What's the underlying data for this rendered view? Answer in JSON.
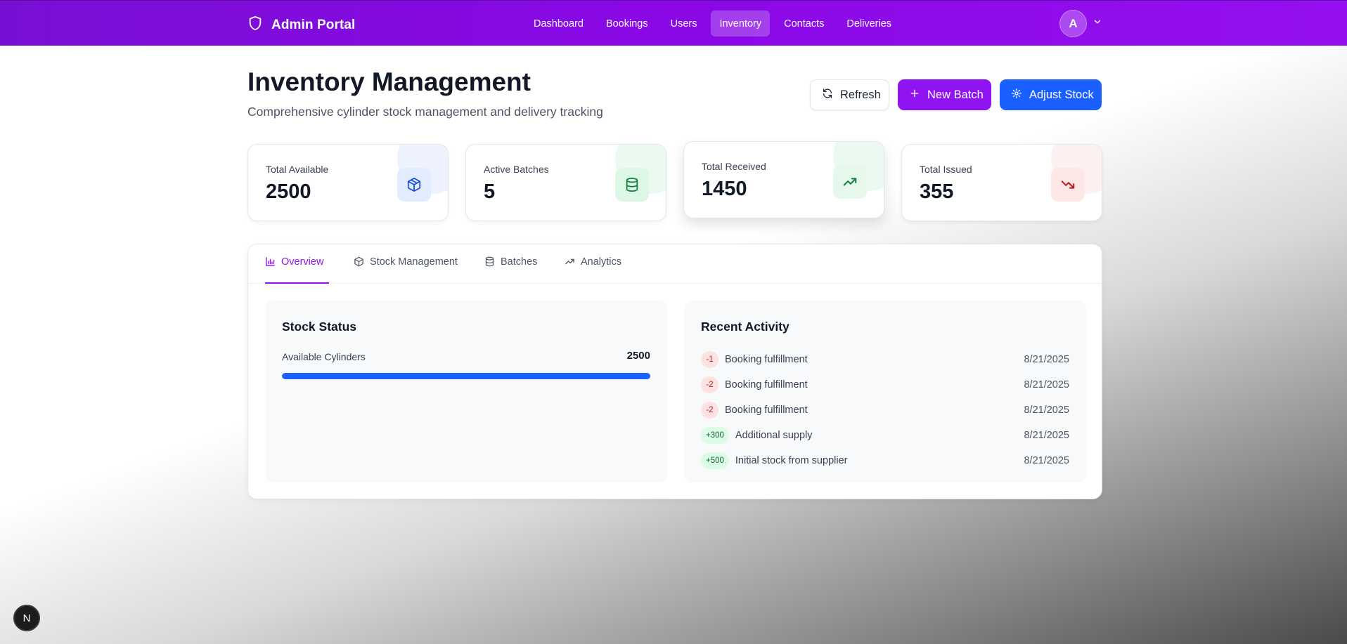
{
  "colors": {
    "brand_purple": "#9013f2",
    "primary_blue": "#1a5fff",
    "danger_red": "#b91c1c",
    "success_green": "#166534"
  },
  "nav": {
    "brand": {
      "icon": "shield-icon",
      "title": "Admin Portal"
    },
    "items": [
      {
        "label": "Dashboard",
        "active": false
      },
      {
        "label": "Bookings",
        "active": false
      },
      {
        "label": "Users",
        "active": false
      },
      {
        "label": "Inventory",
        "active": true
      },
      {
        "label": "Contacts",
        "active": false
      },
      {
        "label": "Deliveries",
        "active": false
      }
    ],
    "user": {
      "avatar_initial": "A",
      "menu_icon": "chevron-down-icon"
    }
  },
  "header": {
    "title": "Inventory Management",
    "subtitle": "Comprehensive cylinder stock management and delivery tracking",
    "actions": {
      "refresh": {
        "label": "Refresh",
        "icon": "refresh-icon"
      },
      "new_batch": {
        "label": "New Batch",
        "icon": "plus-icon"
      },
      "adjust_stock": {
        "label": "Adjust Stock",
        "icon": "gear-icon"
      }
    }
  },
  "stats": [
    {
      "label": "Total Available",
      "value": "2500",
      "icon": "package-icon",
      "color": "#1d4ed8"
    },
    {
      "label": "Active Batches",
      "value": "5",
      "icon": "database-icon",
      "color": "#15803d"
    },
    {
      "label": "Total Received",
      "value": "1450",
      "icon": "trending-up-icon",
      "color": "#15803d"
    },
    {
      "label": "Total Issued",
      "value": "355",
      "icon": "trending-down-icon",
      "color": "#b91c1c"
    }
  ],
  "tabs": [
    {
      "label": "Overview",
      "icon": "bar-chart-icon",
      "active": true
    },
    {
      "label": "Stock Management",
      "icon": "package-icon",
      "active": false
    },
    {
      "label": "Batches",
      "icon": "database-icon",
      "active": false
    },
    {
      "label": "Analytics",
      "icon": "trending-up-icon",
      "active": false
    }
  ],
  "stock_status": {
    "title": "Stock Status",
    "row_label": "Available Cylinders",
    "row_value": "2500",
    "progress_fraction": 1.0
  },
  "recent_activity": {
    "title": "Recent Activity",
    "items": [
      {
        "change": "-1",
        "type": "neg",
        "description": "Booking fulfillment",
        "date": "8/21/2025"
      },
      {
        "change": "-2",
        "type": "neg",
        "description": "Booking fulfillment",
        "date": "8/21/2025"
      },
      {
        "change": "-2",
        "type": "neg",
        "description": "Booking fulfillment",
        "date": "8/21/2025"
      },
      {
        "change": "+300",
        "type": "pos",
        "description": "Additional supply",
        "date": "8/21/2025"
      },
      {
        "change": "+500",
        "type": "pos",
        "description": "Initial stock from supplier",
        "date": "8/21/2025"
      }
    ]
  },
  "dev_badge": {
    "label": "N"
  }
}
